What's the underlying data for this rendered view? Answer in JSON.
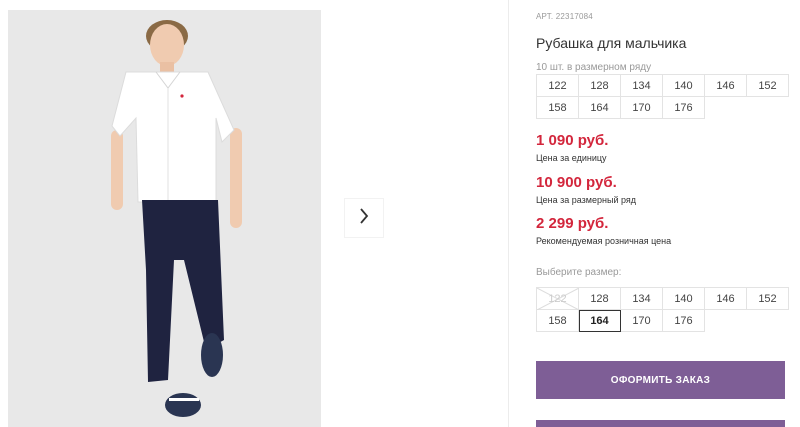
{
  "product": {
    "article": "АРТ. 22317084",
    "title": "Рубашка для мальчика",
    "pack_note": "10 шт. в размерном ряду",
    "pack_sizes": [
      "122",
      "128",
      "134",
      "140",
      "146",
      "152",
      "158",
      "164",
      "170",
      "176"
    ]
  },
  "prices": {
    "unit_price": "1 090 руб.",
    "unit_label": "Цена за единицу",
    "row_price": "10 900 руб.",
    "row_label": "Цена за размерный ряд",
    "retail_price": "2 299 руб.",
    "retail_label": "Рекомендуемая розничная цена",
    "accent_color": "#d3263c"
  },
  "size_select": {
    "label": "Выберите размер:",
    "options": [
      "122",
      "128",
      "134",
      "140",
      "146",
      "152",
      "158",
      "164",
      "170",
      "176"
    ],
    "disabled": "122",
    "selected": "164"
  },
  "actions": {
    "order_label": "ОФОРМИТЬ ЗАКАЗ",
    "button_color": "#7e5e96"
  },
  "gallery": {
    "next_icon": "chevron-right-icon"
  }
}
